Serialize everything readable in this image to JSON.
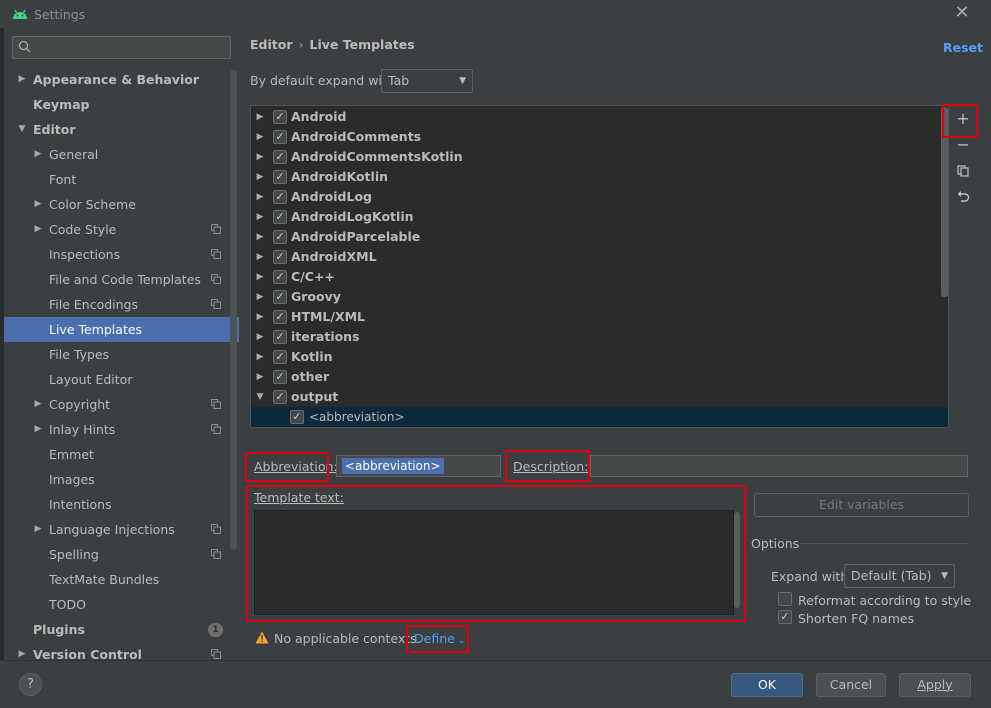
{
  "window": {
    "title": "Settings",
    "close_icon": "close-icon"
  },
  "search": {
    "placeholder": ""
  },
  "sidebar": {
    "items": [
      {
        "label": "Appearance & Behavior",
        "bold": true,
        "arrow": "▶"
      },
      {
        "label": "Keymap",
        "bold": true
      },
      {
        "label": "Editor",
        "bold": true,
        "arrow": "▼"
      },
      {
        "label": "General",
        "arrow": "▶"
      },
      {
        "label": "Font"
      },
      {
        "label": "Color Scheme",
        "arrow": "▶"
      },
      {
        "label": "Code Style",
        "arrow": "▶",
        "project": true
      },
      {
        "label": "Inspections",
        "project": true
      },
      {
        "label": "File and Code Templates",
        "project": true
      },
      {
        "label": "File Encodings",
        "project": true
      },
      {
        "label": "Live Templates",
        "selected": true
      },
      {
        "label": "File Types"
      },
      {
        "label": "Layout Editor"
      },
      {
        "label": "Copyright",
        "arrow": "▶",
        "project": true
      },
      {
        "label": "Inlay Hints",
        "arrow": "▶",
        "project": true
      },
      {
        "label": "Emmet"
      },
      {
        "label": "Images"
      },
      {
        "label": "Intentions"
      },
      {
        "label": "Language Injections",
        "arrow": "▶",
        "project": true
      },
      {
        "label": "Spelling",
        "project": true
      },
      {
        "label": "TextMate Bundles"
      },
      {
        "label": "TODO"
      },
      {
        "label": "Plugins",
        "bold": true,
        "badge": "1"
      },
      {
        "label": "Version Control",
        "bold": true,
        "arrow": "▶",
        "project": true
      }
    ]
  },
  "breadcrumb": {
    "parent": "Editor",
    "sep": "›",
    "current": "Live Templates"
  },
  "reset_label": "Reset",
  "expand": {
    "label": "By default expand with",
    "value": "Tab"
  },
  "template_groups": [
    {
      "label": "Android",
      "checked": true
    },
    {
      "label": "AndroidComments",
      "checked": true
    },
    {
      "label": "AndroidCommentsKotlin",
      "checked": true
    },
    {
      "label": "AndroidKotlin",
      "checked": true
    },
    {
      "label": "AndroidLog",
      "checked": true
    },
    {
      "label": "AndroidLogKotlin",
      "checked": true
    },
    {
      "label": "AndroidParcelable",
      "checked": true
    },
    {
      "label": "AndroidXML",
      "checked": true
    },
    {
      "label": "C/C++",
      "checked": true
    },
    {
      "label": "Groovy",
      "checked": true
    },
    {
      "label": "HTML/XML",
      "checked": true
    },
    {
      "label": "iterations",
      "checked": true
    },
    {
      "label": "Kotlin",
      "checked": true
    },
    {
      "label": "other",
      "checked": true
    },
    {
      "label": "output",
      "checked": true,
      "expanded": true
    }
  ],
  "template_child": {
    "label": "<abbreviation>",
    "checked": true
  },
  "toolbar": {
    "add": "+",
    "remove": "−",
    "copy_icon": "copy-icon",
    "restore_icon": "undo-icon"
  },
  "form": {
    "abbreviation_label": "Abbreviation:",
    "abbreviation_value": "<abbreviation>",
    "description_label": "Description:",
    "description_value": "",
    "template_text_label": "Template text:",
    "template_text_value": "",
    "edit_variables": "Edit variables",
    "options_label": "Options",
    "expand_with_label": "Expand with",
    "expand_with_value": "Default (Tab)",
    "reformat_label": "Reformat according to style",
    "reformat_checked": false,
    "shorten_label": "Shorten FQ names",
    "shorten_checked": true,
    "warning_text": "No applicable contexts.",
    "define_label": "Define"
  },
  "buttons": {
    "help": "?",
    "ok": "OK",
    "cancel": "Cancel",
    "apply": "Apply"
  },
  "colors": {
    "accent": "#4b6eaf",
    "link": "#589df6",
    "highlight": "#e0000f",
    "warning": "#f0a732"
  }
}
